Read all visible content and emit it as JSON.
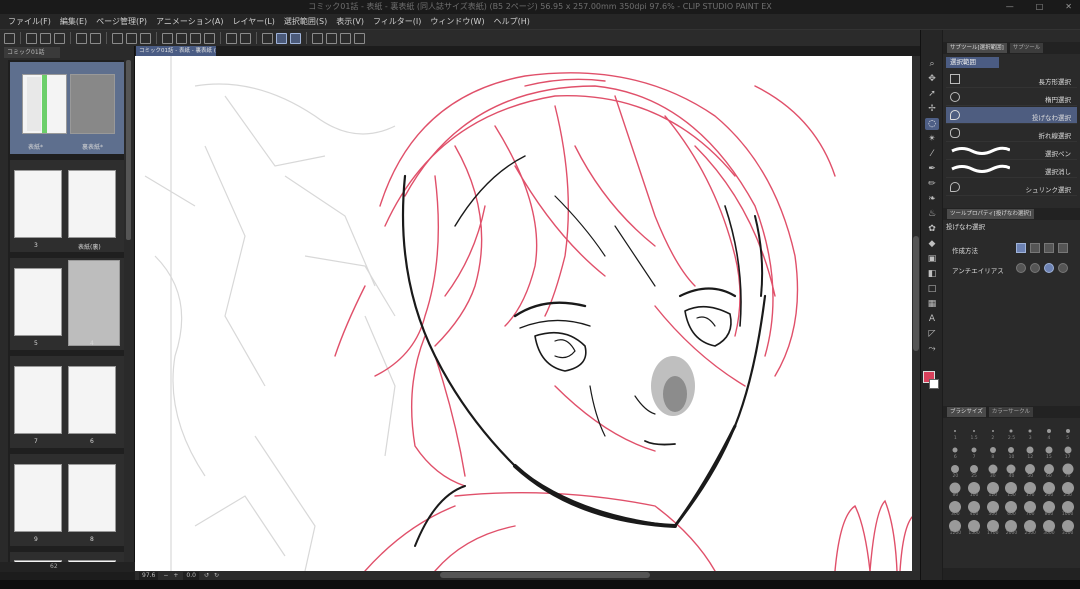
{
  "window": {
    "title": "コミック01話 - 表紙 - 裏表紙 (同人誌サイズ表紙) (B5 2ページ) 56.95 x 257.00mm 350dpi 97.6% - CLIP STUDIO PAINT EX",
    "controls": [
      "—",
      "□",
      "✕"
    ]
  },
  "menu": [
    "ファイル(F)",
    "編集(E)",
    "ページ管理(P)",
    "アニメーション(A)",
    "レイヤー(L)",
    "選択範囲(S)",
    "表示(V)",
    "フィルター(I)",
    "ウィンドウ(W)",
    "ヘルプ(H)"
  ],
  "page_manager": {
    "tab": "コミック01話",
    "spreads": [
      {
        "left": "表紙*",
        "right": "裏表紙*"
      },
      {
        "left": "3",
        "right": "表紙(裏)"
      },
      {
        "left": "5",
        "right": "4"
      },
      {
        "left": "7",
        "right": "6"
      },
      {
        "left": "9",
        "right": "8"
      }
    ],
    "status": "62"
  },
  "document_tab": "コミック01話 - 表紙 - 裏表紙 (1)",
  "status_bar": {
    "zoom": "97.6",
    "angle": "0.0"
  },
  "tools": [
    "magnifier-icon",
    "move-icon",
    "operation-icon",
    "move-layer-icon",
    "lasso-icon",
    "auto-select-icon",
    "eyedropper-icon",
    "pen-icon",
    "pencil-icon",
    "brush-icon",
    "airbrush-icon",
    "decoration-icon",
    "eraser-icon",
    "fill-icon",
    "gradient-icon",
    "figure-icon",
    "frame-icon",
    "text-icon",
    "balloon-icon",
    "line-correction-icon"
  ],
  "colors": {
    "main": "#d9405b",
    "sub": "#ffffff",
    "accent": "#4e5d80"
  },
  "sub_tool": {
    "tabs": [
      "サブツール[選択範囲]",
      "サブツール"
    ],
    "title": "選択範囲",
    "items": [
      {
        "label": "長方形選択",
        "icon": "rect-select-icon"
      },
      {
        "label": "楕円選択",
        "icon": "ellipse-select-icon"
      },
      {
        "label": "投げなわ選択",
        "icon": "lasso-select-icon",
        "selected": true
      },
      {
        "label": "折れ線選択",
        "icon": "polyline-select-icon"
      },
      {
        "label": "選択ペン",
        "icon": "selection-pen-icon"
      },
      {
        "label": "選択消し",
        "icon": "selection-eraser-icon"
      },
      {
        "label": "シュリンク選択",
        "icon": "shrink-select-icon"
      }
    ]
  },
  "tool_property": {
    "tab": "ツールプロパティ[投げなわ選択]",
    "title": "投げなわ選択",
    "rows": [
      {
        "label": "作成方法"
      },
      {
        "label": "アンチエイリアス"
      }
    ]
  },
  "brush_size": {
    "tabs": [
      "ブラシサイズ",
      "カラーサークル"
    ],
    "sizes": [
      "1",
      "1.5",
      "2",
      "2.5",
      "3",
      "4",
      "5",
      "6",
      "7",
      "8",
      "10",
      "12",
      "15",
      "17",
      "20",
      "25",
      "30",
      "40",
      "50",
      "60",
      "70",
      "80",
      "100",
      "120",
      "150",
      "170",
      "200",
      "250",
      "300",
      "400",
      "500",
      "600",
      "700",
      "800",
      "1000",
      "1200",
      "1500",
      "1700",
      "2000",
      "2500",
      "3000",
      "3500"
    ]
  }
}
